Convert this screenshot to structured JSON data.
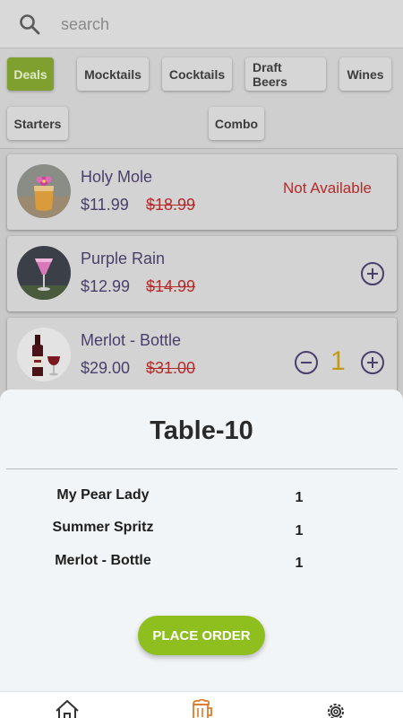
{
  "search": {
    "placeholder": "search"
  },
  "categories": [
    {
      "label": "Deals",
      "active": true
    },
    {
      "label": "Mocktails",
      "active": false
    },
    {
      "label": "Cocktails",
      "active": false
    },
    {
      "label": "Draft Beers",
      "active": false
    },
    {
      "label": "Wines",
      "active": false
    },
    {
      "label": "Starters",
      "active": false
    },
    {
      "label": "Combo",
      "active": false
    }
  ],
  "items": [
    {
      "name": "Holy Mole",
      "price": "$11.99",
      "old_price": "$18.99",
      "status": "Not Available"
    },
    {
      "name": "Purple Rain",
      "price": "$12.99",
      "old_price": "$14.99",
      "action_icon": "plus-circle-icon"
    },
    {
      "name": "Merlot - Bottle",
      "price": "$29.00",
      "old_price": "$31.00",
      "quantity": "1",
      "action_icons": [
        "minus-circle-icon",
        "plus-circle-icon"
      ]
    }
  ],
  "order": {
    "title": "Table-10",
    "lines": [
      {
        "name": "My Pear Lady",
        "qty": "1"
      },
      {
        "name": "Summer Spritz",
        "qty": "1"
      },
      {
        "name": "Merlot - Bottle",
        "qty": "1"
      }
    ],
    "button": "PLACE ORDER"
  },
  "nav": [
    {
      "icon": "home-icon",
      "active": false
    },
    {
      "icon": "beer-mug-icon",
      "active": true
    },
    {
      "icon": "gear-icon",
      "active": false
    }
  ],
  "colors": {
    "accent_green": "#8fbe1f",
    "price_purple": "#4a3f6b",
    "strike_red": "#b52a2a",
    "quantity_gold": "#c29a1a",
    "nav_active": "#e07a2a"
  }
}
